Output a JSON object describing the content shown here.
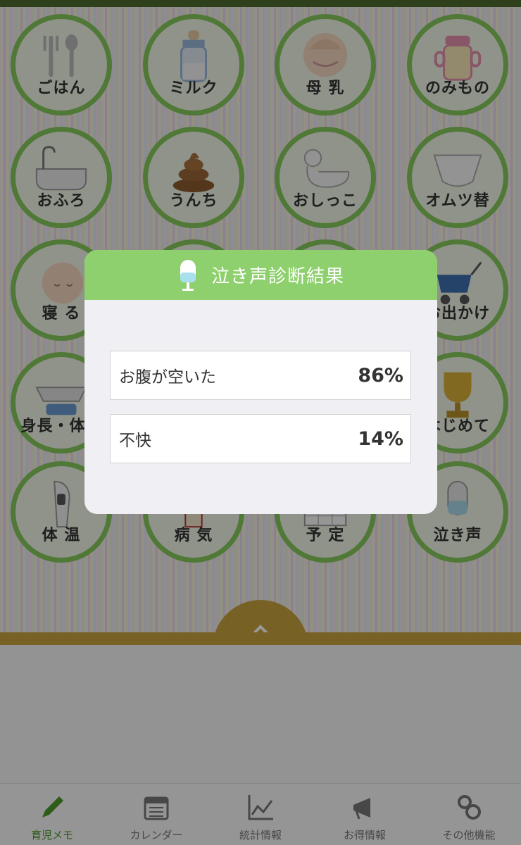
{
  "tiles": [
    {
      "label": "ごはん",
      "icon": "fork-spoon-icon"
    },
    {
      "label": "ミルク",
      "icon": "milk-bottle-icon"
    },
    {
      "label": "母 乳",
      "icon": "breastfeeding-icon"
    },
    {
      "label": "のみもの",
      "icon": "sippy-cup-icon"
    },
    {
      "label": "おふろ",
      "icon": "bathtub-icon"
    },
    {
      "label": "うんち",
      "icon": "poop-icon"
    },
    {
      "label": "おしっこ",
      "icon": "potty-duck-icon"
    },
    {
      "label": "オムツ替",
      "icon": "diaper-icon"
    },
    {
      "label": "寝 る",
      "icon": "sleeping-baby-icon"
    },
    {
      "label": "",
      "icon": ""
    },
    {
      "label": "",
      "icon": ""
    },
    {
      "label": "お出かけ",
      "icon": "stroller-icon"
    },
    {
      "label": "身長・体重",
      "icon": "baby-scale-icon"
    },
    {
      "label": "",
      "icon": ""
    },
    {
      "label": "",
      "icon": ""
    },
    {
      "label": "はじめて",
      "icon": "trophy-icon"
    },
    {
      "label": "体 温",
      "icon": "thermometer-icon"
    },
    {
      "label": "病 気",
      "icon": "medicine-icon"
    },
    {
      "label": "予 定",
      "icon": "calendar-grid-icon"
    },
    {
      "label": "泣き声",
      "icon": "microphone-icon"
    }
  ],
  "tabs": [
    {
      "label": "育児メモ",
      "icon": "pencil-icon",
      "active": true
    },
    {
      "label": "カレンダー",
      "icon": "calendar-icon",
      "active": false
    },
    {
      "label": "統計情報",
      "icon": "stats-chart-icon",
      "active": false
    },
    {
      "label": "お得情報",
      "icon": "megaphone-icon",
      "active": false
    },
    {
      "label": "その他機能",
      "icon": "gears-icon",
      "active": false
    }
  ],
  "dialog": {
    "title": "泣き声診断結果",
    "icon": "microphone-icon",
    "results": [
      {
        "label": "お腹が空いた",
        "percent": "86%"
      },
      {
        "label": "不快",
        "percent": "14%"
      }
    ]
  },
  "colors": {
    "header_green": "#8ed06d",
    "tile_border": "#85c95a",
    "bottom_bar": "#c8a23e",
    "active_tab": "#4e9a2b"
  }
}
